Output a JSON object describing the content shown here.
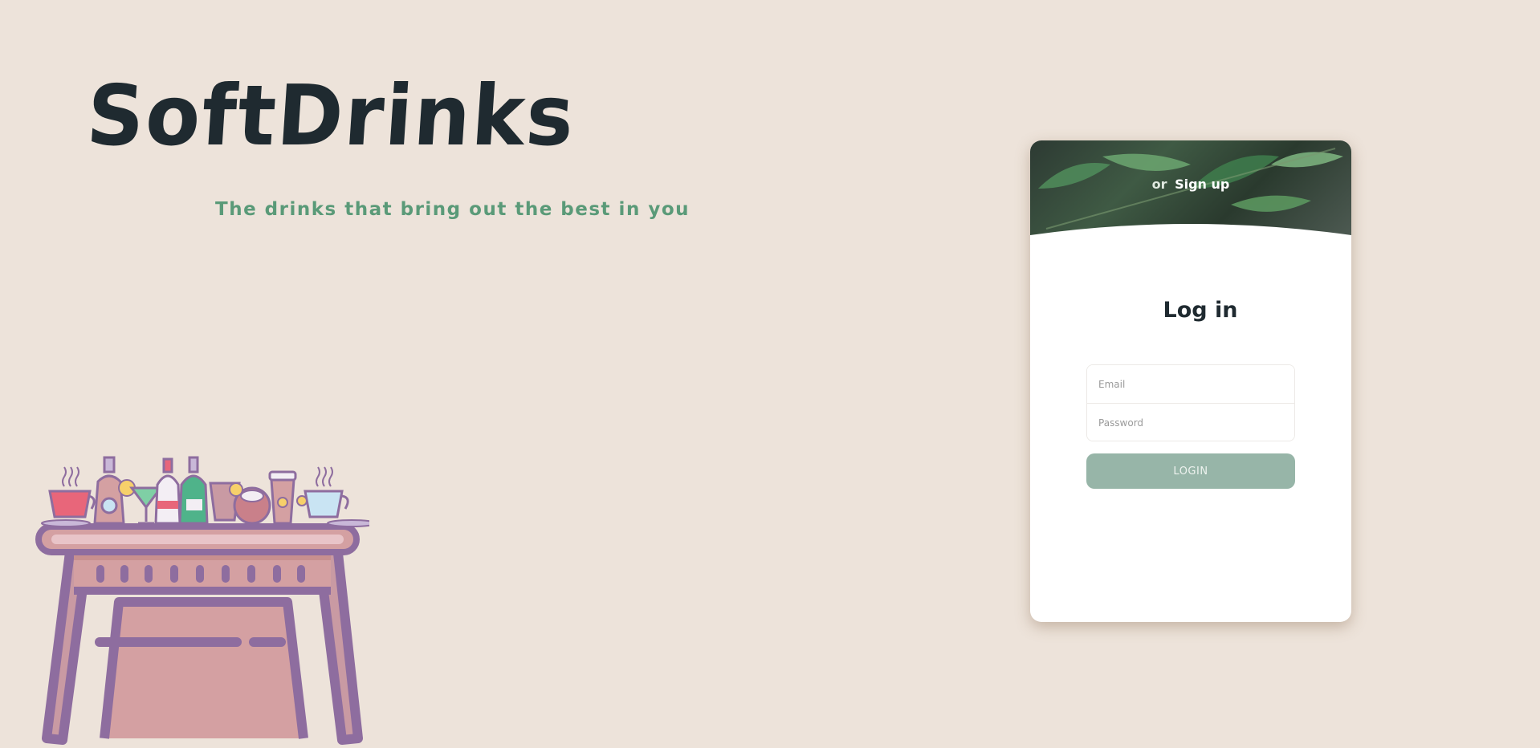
{
  "brand": {
    "name": "SoftDrinks",
    "tagline": "The drinks that bring out the best in you"
  },
  "colors": {
    "background": "#ede3da",
    "brand_text": "#1f2a30",
    "tagline": "#5a9a78",
    "button": "#97b5a8"
  },
  "login_card": {
    "or_text": "or",
    "signup_link": "Sign up",
    "title": "Log in",
    "email_placeholder": "Email",
    "password_placeholder": "Password",
    "login_button": "LOGIN"
  },
  "illustration": {
    "icon": "drinks-table-illustration"
  }
}
